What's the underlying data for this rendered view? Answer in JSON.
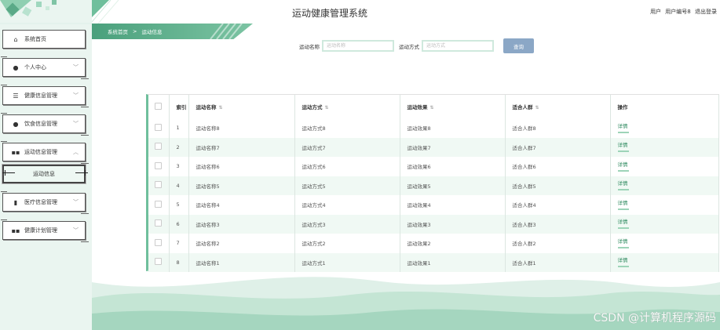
{
  "header": {
    "title": "运动健康管理系统",
    "user_info": [
      "用户",
      "用户编号8",
      "退出登录"
    ]
  },
  "sidebar": {
    "items": [
      {
        "icon": "home-icon",
        "glyph": "⌂",
        "label": "系统首页",
        "has_arrow": false
      },
      {
        "icon": "user-icon",
        "glyph": "●",
        "label": "个人中心",
        "has_arrow": true
      },
      {
        "icon": "sliders-icon",
        "glyph": "☰",
        "label": "健康信息管理",
        "has_arrow": true
      },
      {
        "icon": "user-icon",
        "glyph": "●",
        "label": "饮食信息管理",
        "has_arrow": true
      },
      {
        "icon": "grid-icon",
        "glyph": "▪",
        "label": "运动信息管理",
        "has_arrow": true,
        "expanded": true
      },
      {
        "icon": "bar-chart-icon",
        "glyph": "▮",
        "label": "医疗信息管理",
        "has_arrow": true
      },
      {
        "icon": "grid-icon",
        "glyph": "▪",
        "label": "健康计划管理",
        "has_arrow": true
      }
    ],
    "submenu_label": "运动信息"
  },
  "breadcrumb": {
    "home": "系统首页",
    "separator": ">",
    "current": "运动信息"
  },
  "search": {
    "name_label": "运动名称",
    "name_placeholder": "运动名称",
    "method_label": "运动方式",
    "method_placeholder": "运动方式",
    "button_label": "查询"
  },
  "table": {
    "headers": {
      "index": "索引",
      "name": "运动名称",
      "method": "运动方式",
      "effect": "运动效果",
      "audience": "适合人群",
      "action": "操作"
    },
    "rows": [
      {
        "index": "1",
        "name": "运动名称8",
        "method": "运动方式8",
        "effect": "运动效果8",
        "audience": "适合人群8",
        "action": "详情"
      },
      {
        "index": "2",
        "name": "运动名称7",
        "method": "运动方式7",
        "effect": "运动效果7",
        "audience": "适合人群7",
        "action": "详情"
      },
      {
        "index": "3",
        "name": "运动名称6",
        "method": "运动方式6",
        "effect": "运动效果6",
        "audience": "适合人群6",
        "action": "详情"
      },
      {
        "index": "4",
        "name": "运动名称5",
        "method": "运动方式5",
        "effect": "运动效果5",
        "audience": "适合人群5",
        "action": "详情"
      },
      {
        "index": "5",
        "name": "运动名称4",
        "method": "运动方式4",
        "effect": "运动效果4",
        "audience": "适合人群4",
        "action": "详情"
      },
      {
        "index": "6",
        "name": "运动名称3",
        "method": "运动方式3",
        "effect": "运动效果3",
        "audience": "适合人群3",
        "action": "详情"
      },
      {
        "index": "7",
        "name": "运动名称2",
        "method": "运动方式2",
        "effect": "运动效果2",
        "audience": "适合人群2",
        "action": "详情"
      },
      {
        "index": "8",
        "name": "运动名称1",
        "method": "运动方式1",
        "effect": "运动效果1",
        "audience": "适合人群1",
        "action": "详情"
      }
    ]
  },
  "watermark": "CSDN @计算机程序源码",
  "colors": {
    "accent": "#4aa07c",
    "button": "#8ba7c6",
    "sidebar_bg": "#eaf5f0"
  }
}
